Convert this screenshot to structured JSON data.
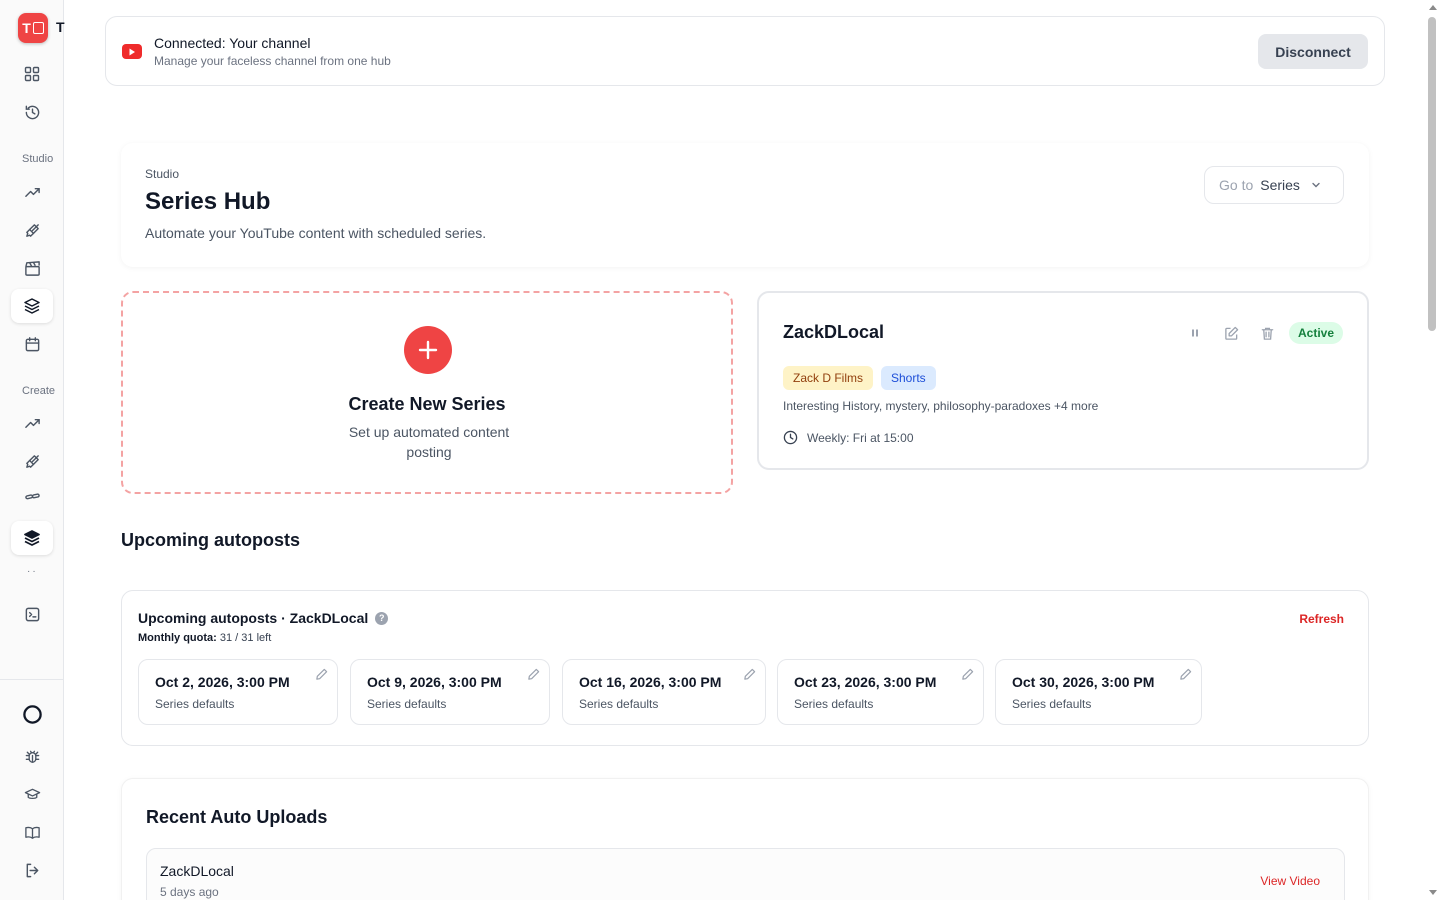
{
  "app": {
    "logo_letter": "T",
    "logo_trail": "T"
  },
  "sidebar": {
    "section_studio": "Studio",
    "section_create": "Create"
  },
  "connection": {
    "title": "Connected: Your channel",
    "subtitle": "Manage your faceless channel from one hub",
    "disconnect_label": "Disconnect"
  },
  "header": {
    "breadcrumb": "Studio",
    "title": "Series Hub",
    "subtitle": "Automate your YouTube content with scheduled series.",
    "goto_label": "Go to",
    "goto_value": "Series"
  },
  "create_card": {
    "title": "Create New Series",
    "subtitle": "Set up automated content posting"
  },
  "series": {
    "name": "ZackDLocal",
    "status": "Active",
    "tags": [
      "Zack D Films",
      "Shorts"
    ],
    "description": "Interesting History, mystery, philosophy-paradoxes +4 more",
    "schedule": "Weekly: Fri at 15:00"
  },
  "upcoming": {
    "heading": "Upcoming autoposts",
    "card_title": "Upcoming autoposts · ZackDLocal",
    "quota_label": "Monthly quota:",
    "quota_value": "31 / 31 left",
    "refresh_label": "Refresh",
    "slots": [
      {
        "date": "Oct 2, 2026, 3:00 PM",
        "source": "Series defaults"
      },
      {
        "date": "Oct 9, 2026, 3:00 PM",
        "source": "Series defaults"
      },
      {
        "date": "Oct 16, 2026, 3:00 PM",
        "source": "Series defaults"
      },
      {
        "date": "Oct 23, 2026, 3:00 PM",
        "source": "Series defaults"
      },
      {
        "date": "Oct 30, 2026, 3:00 PM",
        "source": "Series defaults"
      }
    ]
  },
  "recent": {
    "title": "Recent Auto Uploads",
    "items": [
      {
        "name": "ZackDLocal",
        "time": "5 days ago",
        "action": "View Video"
      }
    ]
  },
  "colors": {
    "accent": "#ef4444",
    "active_badge_bg": "#dcfce7",
    "active_badge_text": "#15803d",
    "link": "#dc2626"
  }
}
